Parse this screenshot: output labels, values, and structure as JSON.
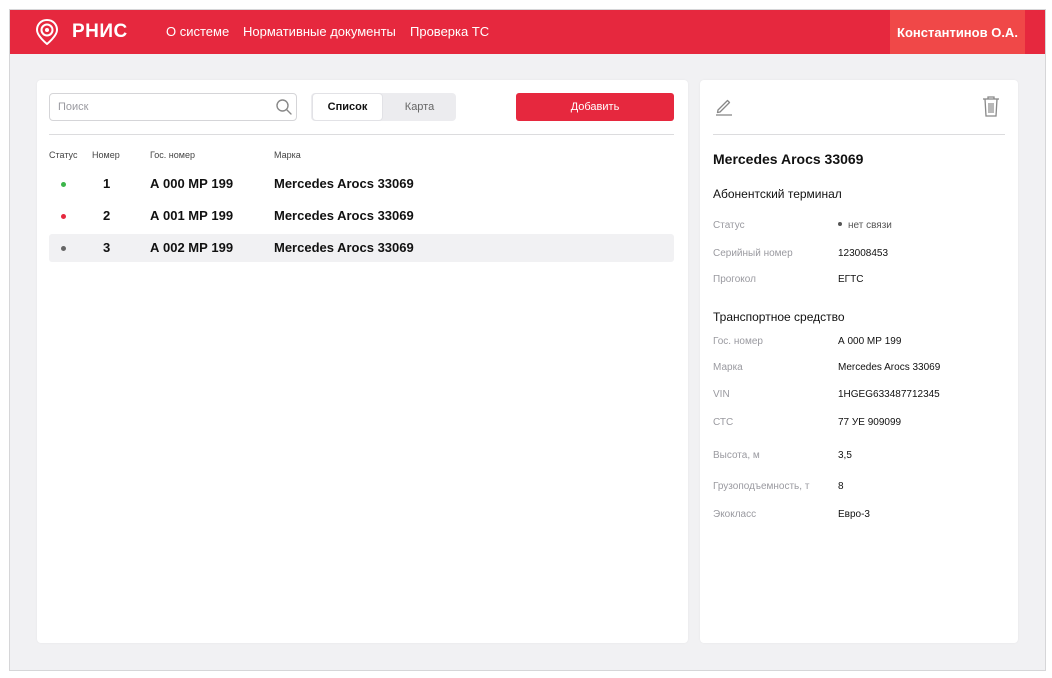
{
  "header": {
    "brand": "РНИС",
    "nav": [
      "О системе",
      "Нормативные документы",
      "Проверка ТС"
    ],
    "user": "Константинов О.А.",
    "accent_color": "#e6283e"
  },
  "list": {
    "search_placeholder": "Поиск",
    "view_toggle": {
      "list_label": "Список",
      "map_label": "Карта",
      "selected": "list"
    },
    "add_label": "Добавить",
    "columns": [
      "Статус",
      "Номер",
      "Гос. номер",
      "Марка"
    ],
    "rows": [
      {
        "status_color": "#3bb54a",
        "number": "1",
        "plate": "А 000 МР 199",
        "make": "Mercedes Arocs 33069"
      },
      {
        "status_color": "#e6283e",
        "number": "2",
        "plate": "А 001 МР 199",
        "make": "Mercedes Arocs 33069"
      },
      {
        "status_color": "#666666",
        "number": "3",
        "plate": "А 002 МР 199",
        "make": "Mercedes Arocs 33069",
        "selected": true
      }
    ]
  },
  "details": {
    "title": "Mercedes Arocs 33069",
    "terminal": {
      "heading": "Абонентский терминал",
      "fields": [
        {
          "label": "Статус",
          "value": "нет связи"
        },
        {
          "label": "Серийный номер",
          "value": "123008453"
        },
        {
          "label": "Прогокол",
          "value": "ЕГТС"
        }
      ]
    },
    "vehicle": {
      "heading": "Транспортное средство",
      "fields": [
        {
          "label": "Гос. номер",
          "value": "А 000 МР 199"
        },
        {
          "label": "Марка",
          "value": "Mercedes Arocs 33069"
        },
        {
          "label": "VIN",
          "value": "1HGEG633487712345"
        },
        {
          "label": "СТС",
          "value": "77 УЕ 909099"
        },
        {
          "label": "Высота, м",
          "value": "3,5"
        },
        {
          "label": "Грузоподъемность, т",
          "value": "8"
        },
        {
          "label": "Экокласс",
          "value": "Евро-3"
        }
      ]
    },
    "icons": [
      "edit-icon",
      "trash-icon"
    ]
  }
}
